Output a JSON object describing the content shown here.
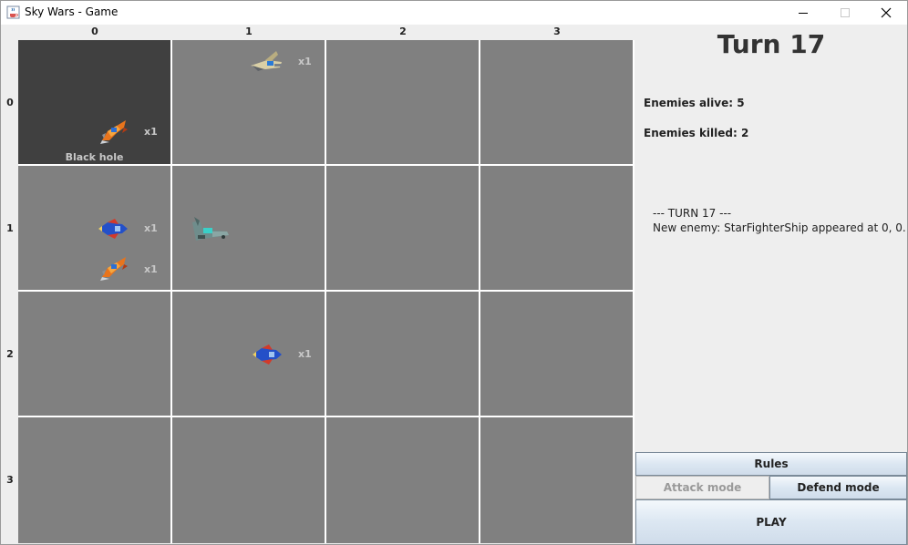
{
  "window": {
    "title": "Sky Wars - Game"
  },
  "grid": {
    "columns": [
      "0",
      "1",
      "2",
      "3"
    ],
    "rows": [
      "0",
      "1",
      "2",
      "3"
    ],
    "black_hole_label": "Black hole",
    "ships": [
      {
        "cell": "0,0",
        "type": "orange-ship",
        "count": "x1"
      },
      {
        "cell": "0,1",
        "type": "tan-ship",
        "count": "x1"
      },
      {
        "cell": "1,0",
        "type": "blue-ship",
        "count": "x1"
      },
      {
        "cell": "1,0",
        "type": "orange-ship",
        "count": "x1"
      },
      {
        "cell": "1,1",
        "type": "teal-player-ship",
        "count": ""
      },
      {
        "cell": "2,1",
        "type": "blue-ship",
        "count": "x1"
      }
    ]
  },
  "panel": {
    "turn_title": "Turn 17",
    "enemies_alive": "Enemies alive: 5",
    "enemies_killed": "Enemies killed: 2",
    "log": [
      "--- TURN 17 ---",
      "New enemy: StarFighterShip appeared at 0, 0."
    ]
  },
  "buttons": {
    "rules": "Rules",
    "attack_mode": "Attack mode",
    "defend_mode": "Defend mode",
    "play": "PLAY"
  },
  "colors": {
    "cell": "#808080",
    "black_hole": "#404040",
    "grid_lines": "#ffffff",
    "panel_bg": "#eeeeee"
  }
}
